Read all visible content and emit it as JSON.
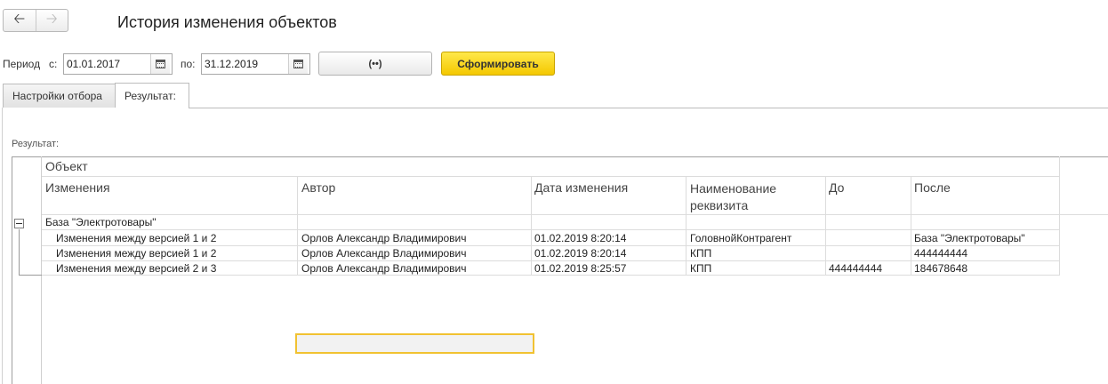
{
  "header": {
    "back_icon": "arrow-left-icon",
    "forward_icon": "arrow-right-icon",
    "title": "История изменения объектов"
  },
  "period": {
    "label": "Период",
    "from_label": "с:",
    "from_value": "01.01.2017",
    "to_label": "по:",
    "to_value": "31.12.2019",
    "period_button_icon": "period-select-icon",
    "generate_label": "Сформировать"
  },
  "tabs": [
    {
      "label": "Настройки отбора",
      "active": false
    },
    {
      "label": "Результат:",
      "active": true
    }
  ],
  "result": {
    "label": "Результат:",
    "columns": {
      "object": "Объект",
      "changes": "Изменения",
      "author": "Автор",
      "date": "Дата изменения",
      "attribute": "Наименование реквизита",
      "before": "До",
      "after": "После"
    },
    "group": {
      "name": "База \"Электротовары\""
    },
    "rows": [
      {
        "change": "Изменения между версией 1 и 2",
        "author": "Орлов Александр Владимирович",
        "date": "01.02.2019 8:20:14",
        "attribute": "ГоловнойКонтрагент",
        "before": "",
        "after": "База \"Электротовары\""
      },
      {
        "change": "Изменения между версией 1 и 2",
        "author": "Орлов Александр Владимирович",
        "date": "01.02.2019 8:20:14",
        "attribute": "КПП",
        "before": "",
        "after": "444444444"
      },
      {
        "change": "Изменения между версией 2 и 3",
        "author": "Орлов Александр Владимирович",
        "date": "01.02.2019 8:25:57",
        "attribute": "КПП",
        "before": "444444444",
        "after": "184678648"
      }
    ]
  },
  "colors": {
    "accent_button": "#f4c800",
    "focus_border": "#f1c232"
  }
}
